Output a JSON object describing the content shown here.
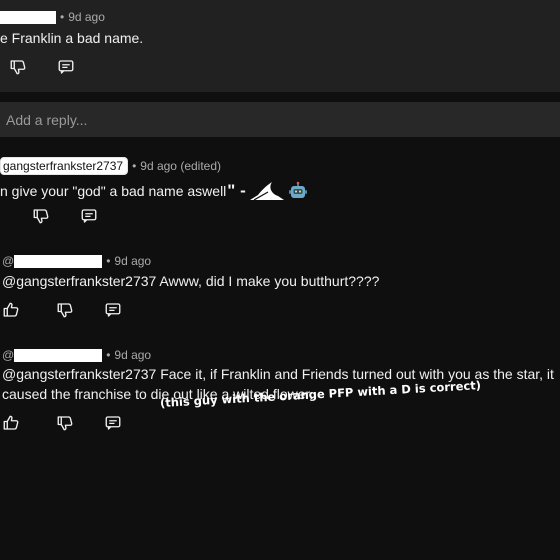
{
  "top_comment": {
    "time": "9d ago",
    "text": "e Franklin a bad name."
  },
  "reply_box": {
    "placeholder": "Add a reply..."
  },
  "comments": [
    {
      "handle": "gangsterfrankster2737",
      "time": "9d ago (edited)",
      "text": "n give your \"god\" a bad name aswell",
      "emoji_tail": "\" - "
    },
    {
      "at": "@",
      "time": "9d ago",
      "text": "@gangsterfrankster2737 Awww, did I make you butthurt????"
    },
    {
      "at": "@",
      "time": "9d ago",
      "text_line1": "@gangsterfrankster2737  Face it, if Franklin and Friends turned out with you as the star, it",
      "text_line2": "caused the franchise to die out like a wilted flower."
    }
  ],
  "overlay_caption": "(this guy with the orange PFP with a D is correct)",
  "icons": [
    "dislike-icon",
    "reply-icon",
    "like-icon",
    "shark-sticker-icon",
    "robot-emoji-icon"
  ]
}
